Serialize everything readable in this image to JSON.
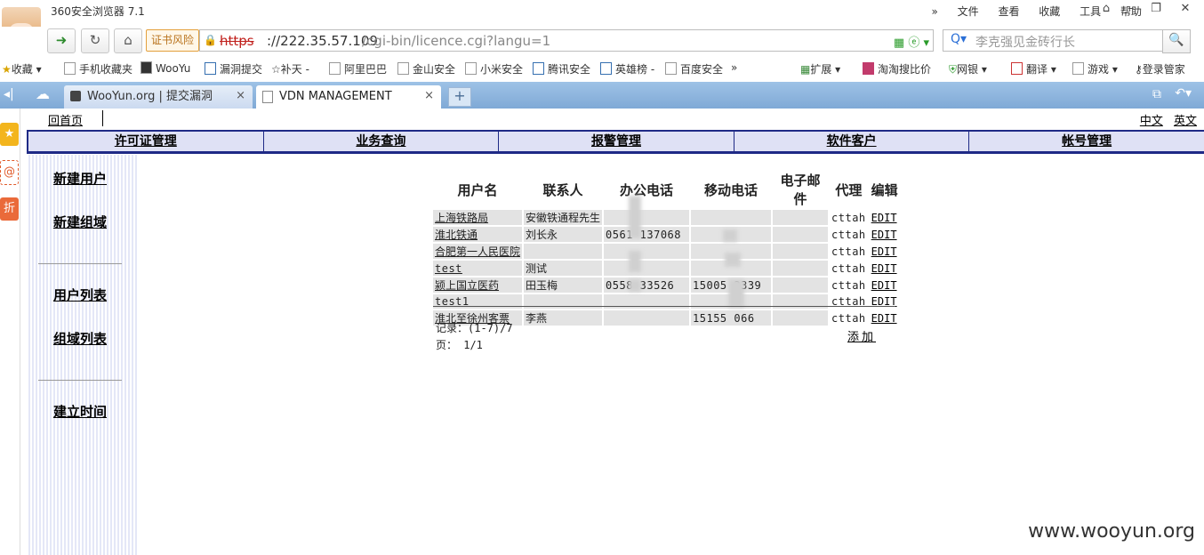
{
  "browser": {
    "app_title": "360安全浏览器 7.1",
    "menu": [
      "»",
      "文件",
      "查看",
      "收藏",
      "工具",
      "帮助"
    ],
    "cert_warning": "证书风险",
    "url_scheme": "https",
    "url_host": "://222.35.57.109",
    "url_path": "/cgi-bin/licence.cgi?langu=1",
    "search_placeholder": "李克强见金砖行长",
    "favorites": [
      "收藏",
      "手机收藏夹",
      "WooYu",
      "漏洞提交",
      "补天 -",
      "阿里巴巴",
      "金山安全",
      "小米安全",
      "腾讯安全",
      "英雄榜 -",
      "百度安全",
      "»",
      "扩展",
      "淘淘搜比价",
      "网银",
      "翻译",
      "游戏",
      "登录管家"
    ],
    "tabs": [
      {
        "label": "WooYun.org | 提交漏洞",
        "active": false
      },
      {
        "label": "VDN MANAGEMENT",
        "active": true
      }
    ]
  },
  "page": {
    "home_link": "回首页",
    "lang_links": [
      "中文",
      "英文"
    ],
    "main_nav": [
      "许可证管理",
      "业务查询",
      "报警管理",
      "软件客户",
      "帐号管理"
    ],
    "left_menu": {
      "group1": [
        "新建用户",
        "新建组域"
      ],
      "group2": [
        "用户列表",
        "组域列表"
      ],
      "group3": [
        "建立时间"
      ]
    },
    "table": {
      "headers": [
        "用户名",
        "联系人",
        "办公电话",
        "移动电话",
        "电子邮件",
        "代理",
        "编辑"
      ],
      "rows": [
        [
          "上海铁路局",
          "安徽铁通程先生",
          "",
          "",
          "",
          "cttah",
          "EDIT"
        ],
        [
          "淮北铁通",
          "刘长永",
          "0561 137068",
          "",
          "",
          "cttah",
          "EDIT"
        ],
        [
          "合肥第一人民医院",
          "",
          "",
          "",
          "",
          "cttah",
          "EDIT"
        ],
        [
          "test",
          "测试",
          "",
          "",
          "",
          "cttah",
          "EDIT"
        ],
        [
          "颍上国立医药",
          "田玉梅",
          "0558 33526",
          "15005 3339",
          "",
          "cttah",
          "EDIT"
        ],
        [
          "test1",
          "",
          "",
          "",
          "",
          "cttah",
          "EDIT"
        ],
        [
          "淮北至徐州客票",
          "李燕",
          "",
          "15155 066",
          "",
          "cttah",
          "EDIT"
        ]
      ]
    },
    "records_label": "记录：(1-7)/7",
    "pages_label": "页：  1/1",
    "add_label": "添加"
  },
  "watermark": "www.wooyun.org",
  "colors": {
    "nav_border": "#1f2a86",
    "nav_bg": "#dfe1f5",
    "tab_bar": "#8fb5df",
    "cell_bg": "#e3e3e3"
  }
}
